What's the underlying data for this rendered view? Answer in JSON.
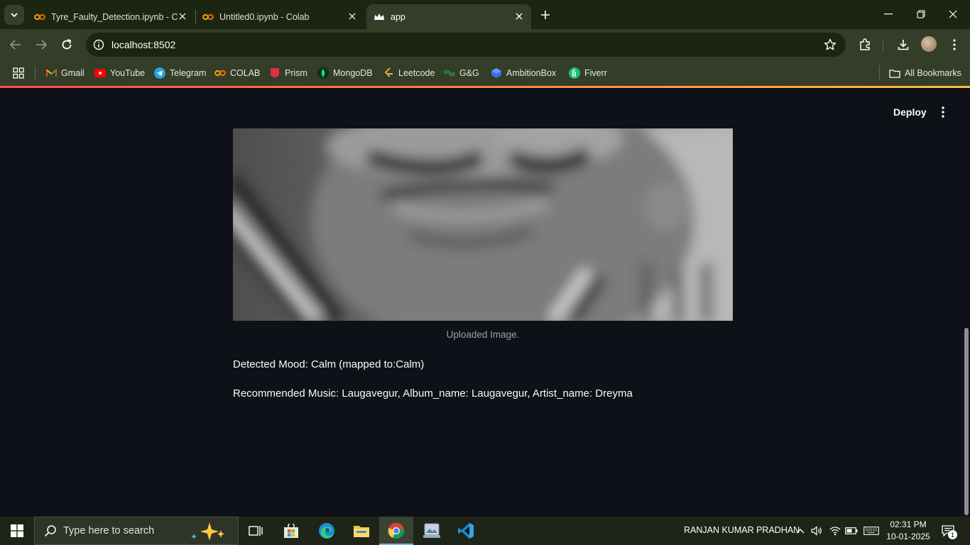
{
  "browser": {
    "tabs": [
      {
        "title": "Tyre_Faulty_Detection.ipynb - C",
        "icon": "colab-icon",
        "active": false
      },
      {
        "title": "Untitled0.ipynb - Colab",
        "icon": "colab-icon",
        "active": false
      },
      {
        "title": "app",
        "icon": "streamlit-crown-icon",
        "active": true
      }
    ],
    "address": "localhost:8502",
    "bookmarks": [
      {
        "label": "Gmail",
        "icon": "gmail-icon"
      },
      {
        "label": "YouTube",
        "icon": "youtube-icon"
      },
      {
        "label": "Telegram",
        "icon": "telegram-icon"
      },
      {
        "label": "COLAB",
        "icon": "colab-icon"
      },
      {
        "label": "Prism",
        "icon": "prism-icon"
      },
      {
        "label": "MongoDB",
        "icon": "mongodb-icon"
      },
      {
        "label": "Leetcode",
        "icon": "leetcode-icon"
      },
      {
        "label": "G&G",
        "icon": "gg-icon"
      },
      {
        "label": "AmbitionBox",
        "icon": "ambitionbox-icon"
      },
      {
        "label": "Fiverr",
        "icon": "fiverr-icon"
      }
    ],
    "all_bookmarks_label": "All Bookmarks"
  },
  "app": {
    "deploy_label": "Deploy",
    "image_caption": "Uploaded Image.",
    "detected_mood": "Detected Mood: Calm (mapped to:Calm)",
    "recommended_music": "Recommended Music: Laugavegur, Album_name: Laugavegur, Artist_name: Dreyma"
  },
  "taskbar": {
    "search_placeholder": "Type here to search",
    "user_name": "RANJAN KUMAR PRADHAN",
    "time": "02:31 PM",
    "date": "10-01-2025",
    "notification_count": "1"
  },
  "colors": {
    "page_bg": "#0e1117",
    "accent_red": "#ff4b4b",
    "frame": "#333d27"
  }
}
